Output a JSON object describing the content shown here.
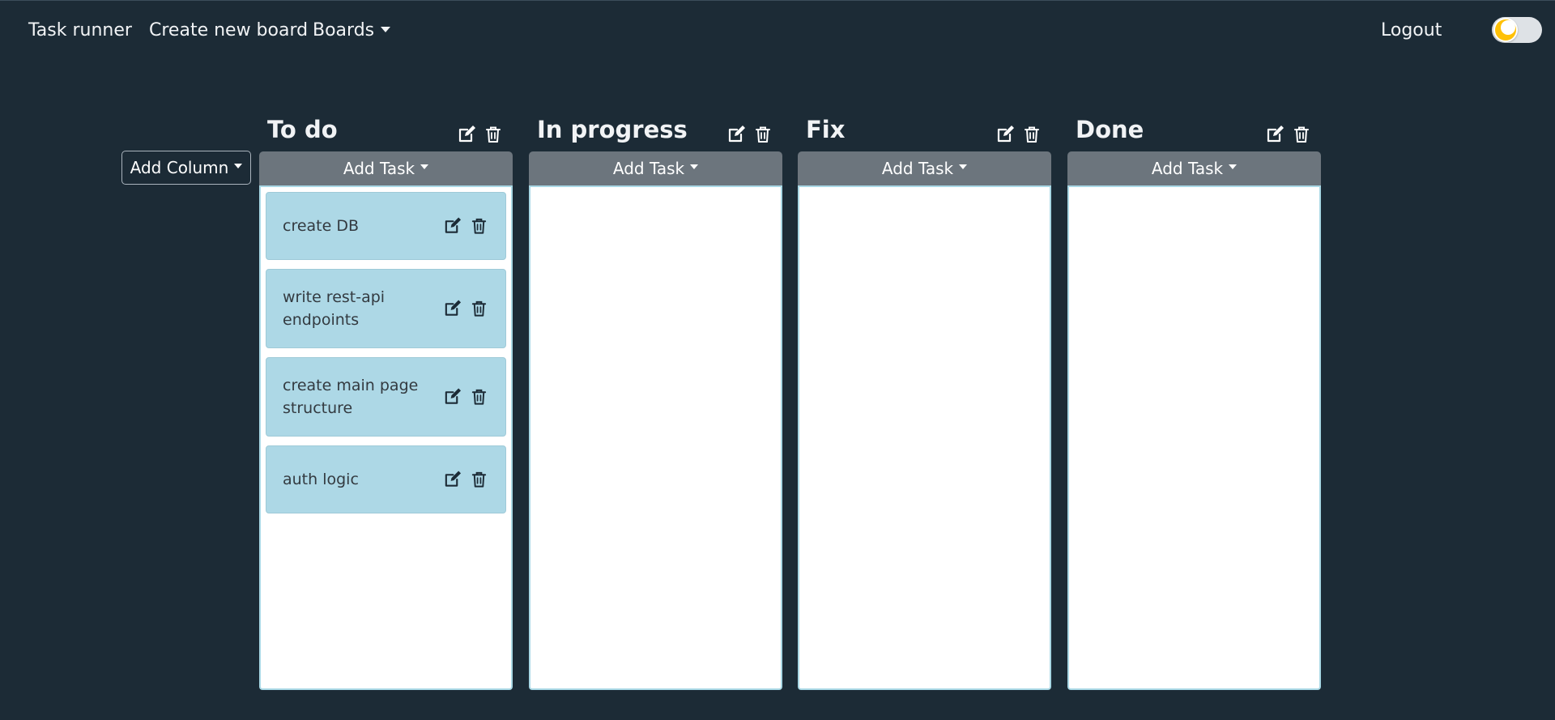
{
  "nav": {
    "brand": "Task runner",
    "create_board": "Create new board",
    "boards": "Boards",
    "logout": "Logout"
  },
  "theme_toggle": {
    "icon": "moon-icon",
    "state": "dark"
  },
  "board": {
    "add_column_label": "Add Column",
    "columns": [
      {
        "title": "To do",
        "add_task_label": "Add Task",
        "tasks": [
          {
            "text": "create DB"
          },
          {
            "text": "write rest-api endpoints"
          },
          {
            "text": "create main page structure"
          },
          {
            "text": "auth logic"
          }
        ]
      },
      {
        "title": "In progress",
        "add_task_label": "Add Task",
        "tasks": []
      },
      {
        "title": "Fix",
        "add_task_label": "Add Task",
        "tasks": []
      },
      {
        "title": "Done",
        "add_task_label": "Add Task",
        "tasks": []
      }
    ]
  },
  "colors": {
    "background": "#1c2b36",
    "button_gray": "#6c757d",
    "task_card": "#add8e6",
    "list_border": "#a9d8e5",
    "toggle_accent": "#ffc107"
  }
}
